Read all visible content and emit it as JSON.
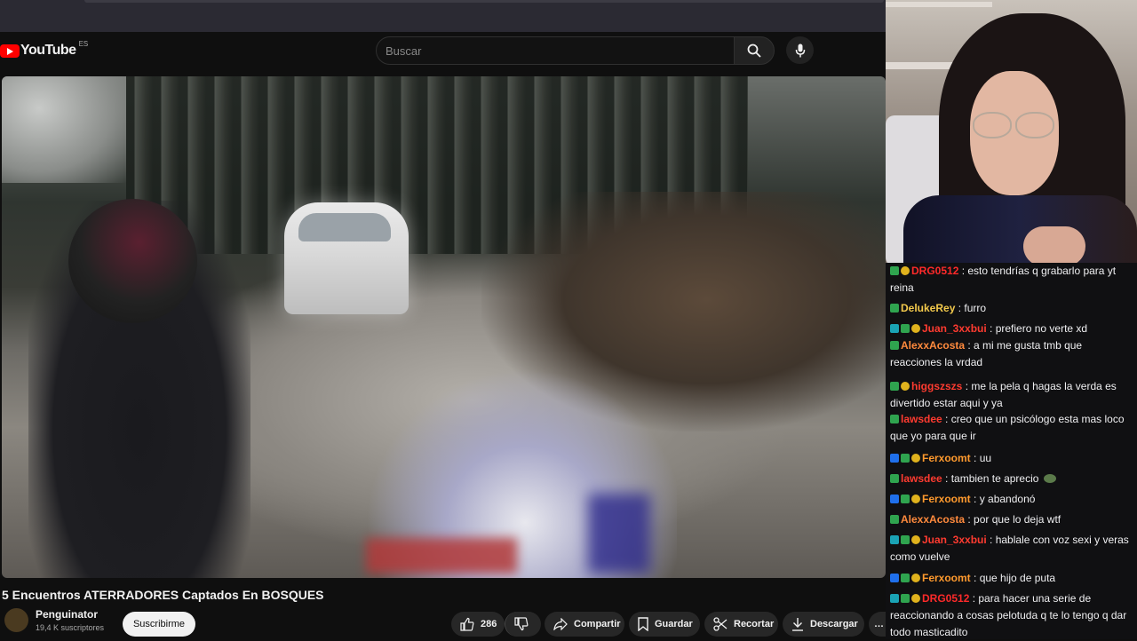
{
  "youtube": {
    "logo_text": "YouTube",
    "country_code": "ES",
    "search_placeholder": "Buscar",
    "video_title": "5 Encuentros ATERRADORES Captados En BOSQUES",
    "channel_name": "Penguinator",
    "subscribers": "19,4 K suscriptores",
    "subscribe_label": "Suscribirme",
    "like_count": "286",
    "share_label": "Compartir",
    "save_label": "Guardar",
    "clip_label": "Recortar",
    "download_label": "Descargar",
    "more_label": "…"
  },
  "chat": [
    {
      "badges": [
        "green",
        "gold"
      ],
      "user": "DRG0512",
      "color": "#ff2a2a",
      "text": "esto tendrías q grabarlo para yt reina"
    },
    {
      "badges": [
        "green"
      ],
      "user": "DelukeRey",
      "color": "#f2c94c",
      "text": "furro"
    },
    {
      "badges": [
        "teal",
        "green",
        "gold"
      ],
      "user": "Juan_3xxbui",
      "color": "#ff3b30",
      "text": "prefiero no verte xd"
    },
    {
      "badges": [
        "green"
      ],
      "user": "AlexxAcosta",
      "color": "#ff8a3d",
      "text": "a mi me gusta tmb que reacciones la vrdad"
    },
    {
      "badges": [
        "green",
        "gold"
      ],
      "user": "higgszszs",
      "color": "#ff3b30",
      "text": "me la pela q hagas la verda es divertido estar aqui y ya"
    },
    {
      "badges": [
        "green"
      ],
      "user": "lawsdee",
      "color": "#ff3b30",
      "text": "creo que un psicólogo esta mas loco que yo para que ir"
    },
    {
      "badges": [
        "blue",
        "green",
        "gold"
      ],
      "user": "Ferxoomt",
      "color": "#ff9a2e",
      "text": "uu"
    },
    {
      "badges": [
        "green"
      ],
      "user": "lawsdee",
      "color": "#ff3b30",
      "text": "tambien te aprecio"
    },
    {
      "badges": [
        "blue",
        "green",
        "gold"
      ],
      "user": "Ferxoomt",
      "color": "#ff9a2e",
      "text": "y abandonó"
    },
    {
      "badges": [
        "green"
      ],
      "user": "AlexxAcosta",
      "color": "#ff8a3d",
      "text": "por que lo deja wtf"
    },
    {
      "badges": [
        "teal",
        "green",
        "gold"
      ],
      "user": "Juan_3xxbui",
      "color": "#ff3b30",
      "text": "hablale con voz sexi y veras como vuelve"
    },
    {
      "badges": [
        "blue",
        "green",
        "gold"
      ],
      "user": "Ferxoomt",
      "color": "#ff9a2e",
      "text": "que hijo de puta"
    },
    {
      "badges": [
        "teal",
        "green",
        "gold"
      ],
      "user": "DRG0512",
      "color": "#ff2a2a",
      "text": "para hacer una serie de reaccionando a cosas pelotuda q te lo tengo q dar todo masticadito"
    }
  ],
  "icons": [
    "search-icon",
    "mic-icon",
    "like-icon",
    "dislike-icon",
    "share-icon",
    "save-icon",
    "clip-icon",
    "download-icon",
    "more-icon"
  ]
}
